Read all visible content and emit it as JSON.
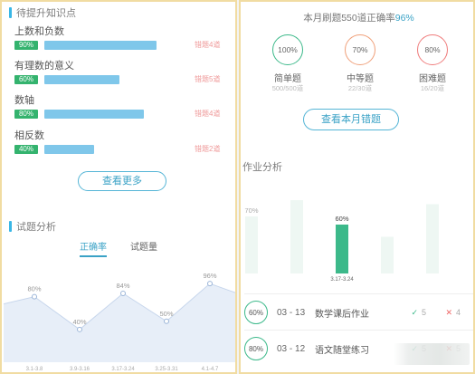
{
  "left": {
    "knowledge_title": "待提升知识点",
    "topics": [
      {
        "name": "上数和负数",
        "rate": "90%",
        "progress": 0.9,
        "errors": "错题4道"
      },
      {
        "name": "有理数的意义",
        "rate": "60%",
        "progress": 0.6,
        "errors": "错题5道"
      },
      {
        "name": "数轴",
        "rate": "80%",
        "progress": 0.8,
        "errors": "错题4道"
      },
      {
        "name": "相反数",
        "rate": "40%",
        "progress": 0.4,
        "errors": "错题2道"
      }
    ],
    "more_button": "查看更多",
    "test_title": "试题分析",
    "tabs": [
      "正确率",
      "试题量"
    ],
    "active_tab": 0,
    "chart_data": {
      "type": "area",
      "categories": [
        "3.1-3.8",
        "3.9-3.16",
        "3.17-3.24",
        "3.25-3.31",
        "4.1-4.7"
      ],
      "values": [
        80,
        40,
        84,
        50,
        96
      ],
      "labels": [
        "80%",
        "40%",
        "84%",
        "50%",
        "96%"
      ],
      "ylim": [
        0,
        130
      ],
      "grid": false
    }
  },
  "right": {
    "summary_prefix": "本月刷题550道正确率",
    "summary_rate": "96%",
    "levels": [
      {
        "pct": "100%",
        "label": "简单题",
        "count": "500/500道",
        "color": "#3cb98a"
      },
      {
        "pct": "70%",
        "label": "中等题",
        "count": "22/30道",
        "color": "#f0a07a"
      },
      {
        "pct": "80%",
        "label": "困难题",
        "count": "16/20道",
        "color": "#ef7b7b"
      }
    ],
    "wrong_button": "查看本月错题",
    "homework_title": "作业分析",
    "hw_chart": {
      "type": "bar",
      "categories": [
        "",
        "",
        "3.17-3.24",
        "",
        ""
      ],
      "values": [
        70,
        90,
        60,
        45,
        85
      ],
      "labels": [
        "70%",
        "",
        "60%",
        "",
        ""
      ],
      "highlight": 2,
      "ylim": [
        0,
        100
      ],
      "colors": {
        "bar": "#eef7f3",
        "active": "#3cb98a"
      }
    },
    "homework": [
      {
        "score": "60%",
        "date": "03 - 13",
        "name": "数学课后作业",
        "correct": "5",
        "wrong": "4"
      },
      {
        "score": "80%",
        "date": "03 - 12",
        "name": "语文随堂练习",
        "correct": "5",
        "wrong": "5"
      }
    ],
    "icons": {
      "correct": "check-icon",
      "wrong": "cross-icon",
      "marker": "triangle-down-icon"
    }
  }
}
